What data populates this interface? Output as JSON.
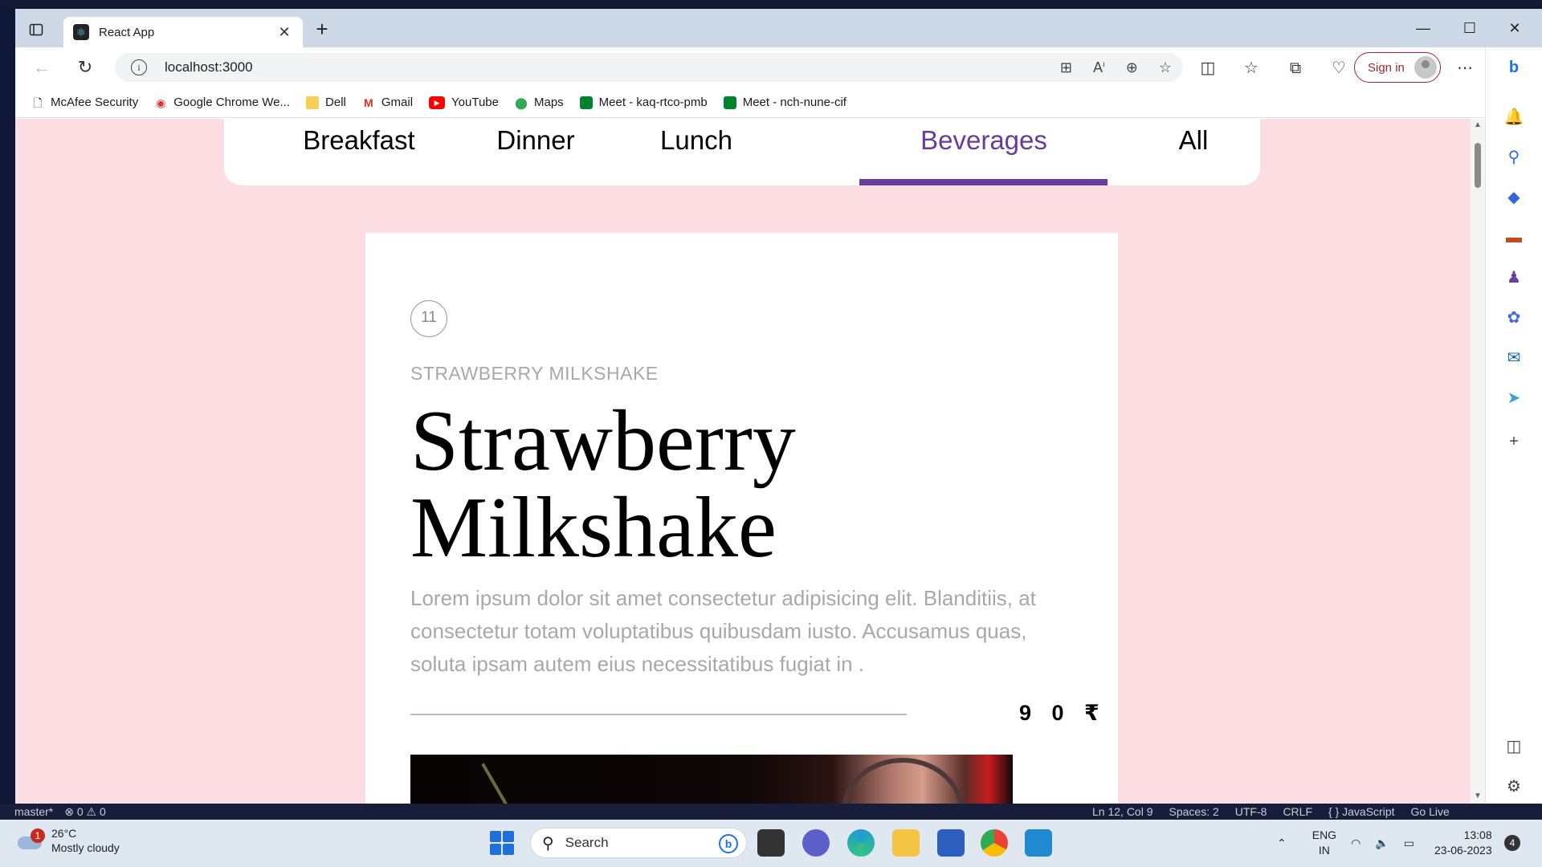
{
  "browser": {
    "tab_title": "React App",
    "url": "localhost:3000",
    "sign_in": "Sign in",
    "bookmarks": [
      {
        "label": "McAfee Security",
        "icon": "document-icon"
      },
      {
        "label": "Google Chrome We...",
        "icon": "chrome-icon"
      },
      {
        "label": "Dell",
        "icon": "folder-icon"
      },
      {
        "label": "Gmail",
        "icon": "gmail-icon"
      },
      {
        "label": "YouTube",
        "icon": "youtube-icon"
      },
      {
        "label": "Maps",
        "icon": "maps-icon"
      },
      {
        "label": "Meet - kaq-rtco-pmb",
        "icon": "meet-icon"
      },
      {
        "label": "Meet - nch-nune-cif",
        "icon": "meet-icon"
      }
    ]
  },
  "menu": {
    "items": [
      "Breakfast",
      "Dinner",
      "Lunch",
      "Beverages",
      "All"
    ],
    "active": "Beverages",
    "accent_color": "#6a3a9e"
  },
  "item": {
    "number": "11",
    "category_label": "STRAWBERRY MILKSHAKE",
    "title": "Strawberry Milkshake",
    "description": "Lorem ipsum dolor sit amet consectetur adipisicing elit. Blanditiis, at consectetur totam voluptatibus quibusdam iusto. Accusamus quas, soluta ipsam autem eius necessitatibus fugiat in .",
    "price": "9 0 ₹"
  },
  "page_colors": {
    "background": "#fcdde2",
    "card": "#ffffff"
  },
  "statusbar": {
    "branch": "master*",
    "problems": "⊗ 0 ⚠ 0",
    "position": "Ln 12, Col 9",
    "spaces": "Spaces: 2",
    "encoding": "UTF-8",
    "eol": "CRLF",
    "language": "{ } JavaScript",
    "golive": "Go Live"
  },
  "taskbar": {
    "weather_temp": "26°C",
    "weather_desc": "Mostly cloudy",
    "weather_badge": "1",
    "search_label": "Search",
    "lang_line1": "ENG",
    "lang_line2": "IN",
    "time": "13:08",
    "date": "23-06-2023",
    "notification_count": "4"
  }
}
